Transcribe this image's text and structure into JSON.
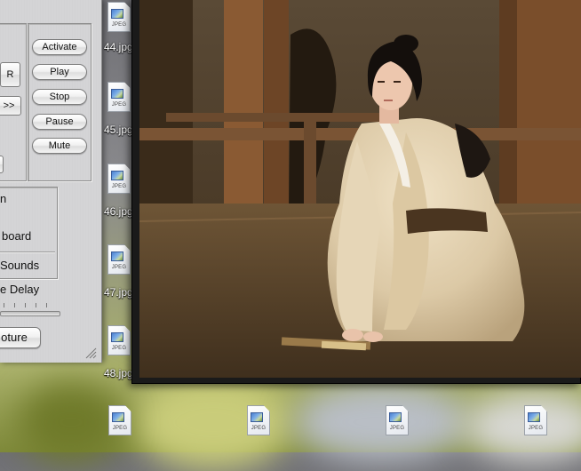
{
  "panel": {
    "buttons": [
      "Activate",
      "Play",
      "Stop",
      "Pause",
      "Mute"
    ],
    "r_button": "R",
    "next_button": ">>",
    "options": [
      "n",
      "board",
      "Sounds"
    ],
    "delay_label": "e Delay",
    "capture_button": "oture"
  },
  "desktop": {
    "files_column": [
      "44.jpg",
      "45.jpg",
      "46.jpg",
      "47.jpg",
      "48.jpg"
    ],
    "file_type_tag": "JPEG"
  },
  "movie": {
    "scene": "woman-in-kimono-kneeling"
  },
  "colors": {
    "panel_metal": "#d4d4d6",
    "movie_border": "#1a1a1a",
    "kimono": "#e4d3b4",
    "wood_floor": "#5a452c"
  }
}
